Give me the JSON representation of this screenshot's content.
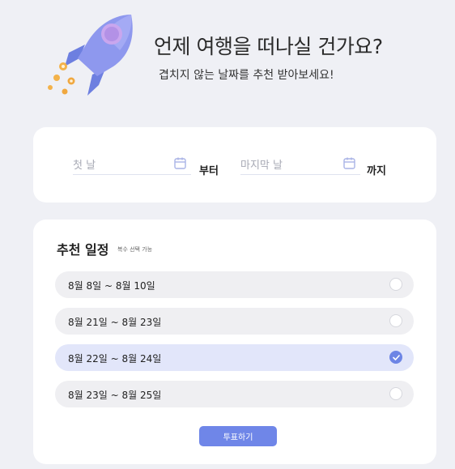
{
  "header": {
    "title": "언제 여행을 떠나실 건가요?",
    "subtitle": "겹치지 않는 날짜를 추천 받아보세요!",
    "illustration": "rocket-icon"
  },
  "date_range": {
    "start_placeholder": "첫 날",
    "start_suffix": "부터",
    "end_placeholder": "마지막 날",
    "end_suffix": "까지",
    "calendar_icon": "calendar-icon"
  },
  "recommendations": {
    "title": "추천 일정",
    "hint": "복수 선택 가능",
    "options": [
      {
        "label": "8월 8일 ~ 8월 10일",
        "selected": false
      },
      {
        "label": "8월 21일 ~ 8월 23일",
        "selected": false
      },
      {
        "label": "8월 22일 ~ 8월 24일",
        "selected": true
      },
      {
        "label": "8월 23일 ~ 8월 25일",
        "selected": false
      }
    ],
    "vote_label": "투표하기"
  },
  "colors": {
    "accent": "#6f86e8",
    "selected_bg": "#e2e6fa",
    "option_bg": "#efeff2",
    "page_bg": "#eff0f5"
  }
}
